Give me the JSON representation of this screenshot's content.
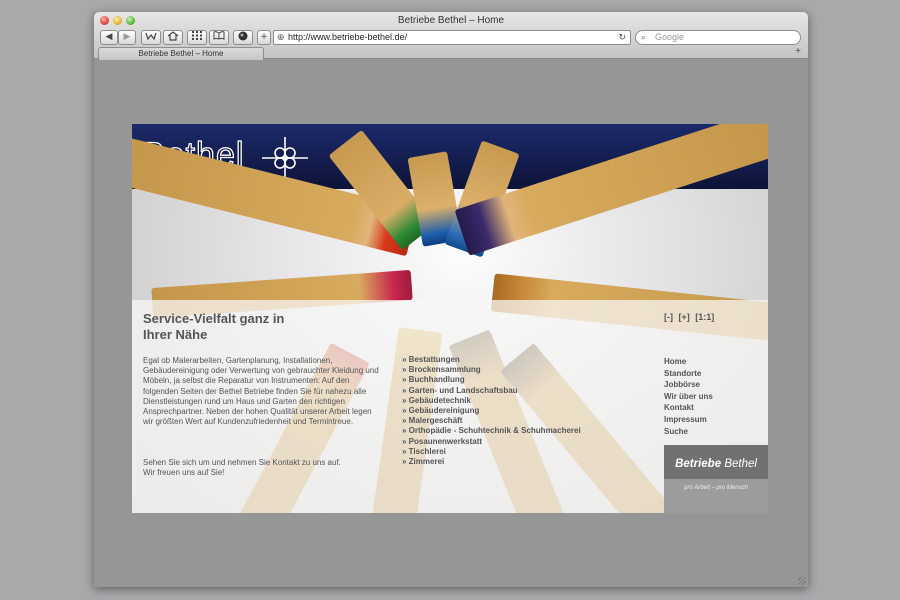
{
  "window": {
    "title": "Betriebe Bethel – Home",
    "url": "http://www.betriebe-bethel.de/",
    "search_placeholder": "Google",
    "tab_label": "Betriebe Bethel – Home",
    "new_tab": "+",
    "nav_back": "◀",
    "nav_forward": "▶",
    "add_bookmark": "+",
    "reload": "↻"
  },
  "site": {
    "logo_text": "Bethel",
    "heading": "Service-Vielfalt ganz in Ihrer Nähe",
    "zoom": {
      "minus": "[-]",
      "plus": "[+]",
      "reset": "[1:1]"
    },
    "intro": "Egal ob Malerarbeiten, Gartenplanung, Installationen, Gebäudereinigung oder Verwertung von gebrauchter Kleidung und Möbeln, ja selbst die Reparatur von Instrumenten: Auf den folgenden Seiten der Bethel Betriebe finden Sie für nahezu alle Dienstleistungen rund um Haus und Garten den richtigen Ansprechpartner. Neben der hohen Qualität unserer Arbeit legen wir größten Wert auf Kundenzufriedenheit und Termintreue.",
    "outro_1": "Sehen Sie sich um und nehmen Sie Kontakt zu uns auf.",
    "outro_2": "Wir freuen uns auf Sie!",
    "services": [
      "Bestattungen",
      "Brockensammlung",
      "Buchhandlung",
      "Garten- und Landschaftsbau",
      "Gebäudetechnik",
      "Gebäudereinigung",
      "Malergeschäft",
      "Orthopädie - Schuhtechnik & Schuhmacherei",
      "Posaunenwerkstatt",
      "Tischlerei",
      "Zimmerei"
    ],
    "nav": [
      "Home",
      "Standorte",
      "Jobbörse",
      "Wir über uns",
      "Kontakt",
      "Impressum",
      "Suche"
    ],
    "brand_bold": "Betriebe",
    "brand_rest": "Bethel",
    "brand_slogan": "pro Arbeit – pro Mensch"
  },
  "colors": {
    "header": "#0d1338",
    "text": "#555555",
    "brandbox": "#717171"
  }
}
